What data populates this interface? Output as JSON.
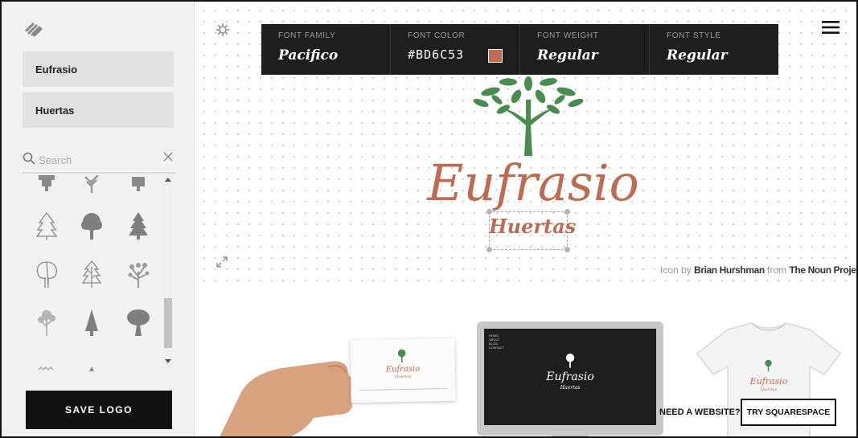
{
  "sidebar": {
    "logo_icon": "squarespace-logo-icon",
    "field_1": "Eufrasio",
    "field_2": "Huertas",
    "search": {
      "placeholder": "Search",
      "icon": "search-icon",
      "clear_icon": "close-icon"
    },
    "icon_grid": [
      "tree-icon-partial-1",
      "tree-icon-partial-2",
      "tree-icon-partial-3",
      "pine-outline-icon",
      "round-tree-icon",
      "pine-tree-icon",
      "oak-outline-icon",
      "pine-outline-2-icon",
      "leafy-tree-icon",
      "leafy-tree-2-icon",
      "cypress-icon",
      "oak-tree-icon",
      "tree-icon-partial-4",
      "tree-icon-partial-5"
    ],
    "save_label": "SAVE LOGO"
  },
  "toolbar": {
    "font_family_label": "FONT FAMILY",
    "font_family_value": "Pacifico",
    "font_color_label": "FONT COLOR",
    "font_color_value": "#BD6C53",
    "font_weight_label": "FONT WEIGHT",
    "font_weight_value": "Regular",
    "font_style_label": "FONT STYLE",
    "font_style_value": "Regular"
  },
  "logo": {
    "title": "Eufrasio",
    "subtitle": "Huertas",
    "color": "#BD6C53",
    "tree_color": "#4A8B4F",
    "icon": "tree-logo-icon"
  },
  "credit": {
    "prefix": "Icon by",
    "author": "Brian Hurshman",
    "middle": "from",
    "source": "The Noun Project"
  },
  "mockups": {
    "card_title": "Eufrasio",
    "card_subtitle": "Huertas",
    "monitor_title": "Eufrasio",
    "monitor_subtitle": "Huertas",
    "monitor_nav": [
      "HOME",
      "ABOUT",
      "BLOG",
      "CONTACT"
    ],
    "shirt_title": "Eufrasio",
    "shirt_subtitle": "Huertas"
  },
  "cta": {
    "need_website": "NEED A WEBSITE?",
    "try_label": "TRY SQUARESPACE"
  }
}
